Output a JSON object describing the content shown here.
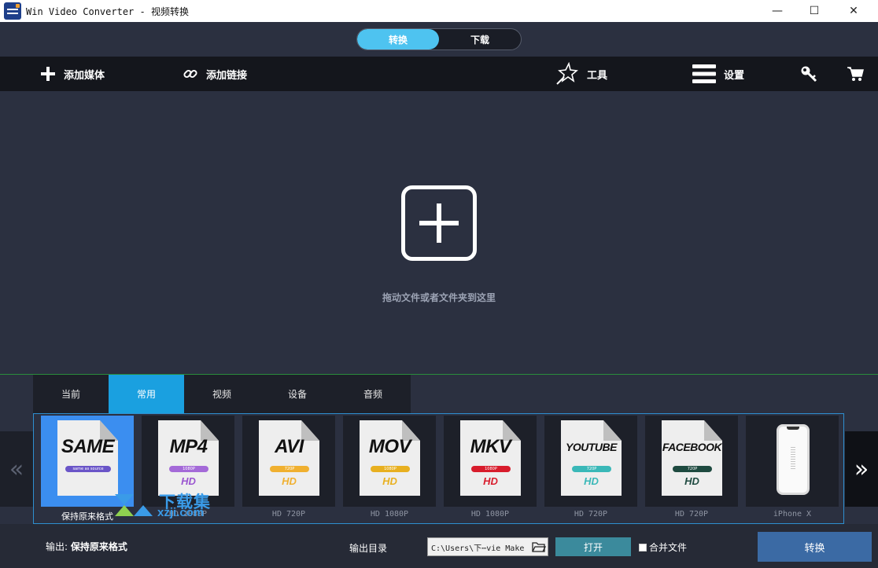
{
  "window": {
    "title": "Win Video Converter - 视频转换",
    "minimize_glyph": "—",
    "maximize_glyph": "☐",
    "close_glyph": "✕"
  },
  "mode_switch": {
    "tabs": [
      {
        "label": "转换",
        "active": true
      },
      {
        "label": "下载",
        "active": false
      }
    ]
  },
  "toolbar": {
    "add_media": "添加媒体",
    "add_link": "添加链接",
    "tools": "工具",
    "settings": "设置",
    "icons": [
      "plus-icon",
      "link-icon",
      "magic-wand-icon",
      "menu-icon",
      "key-icon",
      "cart-icon"
    ]
  },
  "drop_area": {
    "hint": "拖动文件或者文件夹到这里"
  },
  "format_tabs": [
    {
      "label": "当前",
      "active": false
    },
    {
      "label": "常用",
      "active": true
    },
    {
      "label": "视频",
      "active": false
    },
    {
      "label": "设备",
      "active": false
    },
    {
      "label": "音频",
      "active": false
    }
  ],
  "nav": {
    "prev": "«",
    "next": "»"
  },
  "formats": [
    {
      "name": "SAME",
      "sub": "same as source",
      "hd": "",
      "caption": "保持原来格式",
      "pill_color": "#6a55c8",
      "hd_color": "",
      "selected": true
    },
    {
      "name": "MP4",
      "sub": "1080P",
      "hd": "HD",
      "caption": "HD 1080P",
      "pill_color": "#a46ad8",
      "hd_color": "#9a55d0",
      "selected": false
    },
    {
      "name": "AVI",
      "sub": "720P",
      "hd": "HD",
      "caption": "HD 720P",
      "pill_color": "#f0b030",
      "hd_color": "#f0b030",
      "selected": false
    },
    {
      "name": "MOV",
      "sub": "1080P",
      "hd": "HD",
      "caption": "HD 1080P",
      "pill_color": "#e8b020",
      "hd_color": "#e8b020",
      "selected": false
    },
    {
      "name": "MKV",
      "sub": "1080P",
      "hd": "HD",
      "caption": "HD 1080P",
      "pill_color": "#d81c2c",
      "hd_color": "#d81c2c",
      "selected": false
    },
    {
      "name": "YOUTUBE",
      "sub": "720P",
      "hd": "HD",
      "caption": "HD 720P",
      "pill_color": "#3ab8b8",
      "hd_color": "#3ab8b8",
      "selected": false
    },
    {
      "name": "FACEBOOK",
      "sub": "720P",
      "hd": "HD",
      "caption": "HD 720P",
      "pill_color": "#1e4a40",
      "hd_color": "#1e4a40",
      "selected": false
    },
    {
      "name": "",
      "sub": "",
      "hd": "",
      "caption": "iPhone X",
      "pill_color": "",
      "hd_color": "",
      "selected": false
    }
  ],
  "watermark": {
    "text": "下载集",
    "url": "xzji.com"
  },
  "bottom": {
    "output_prefix": "输出: ",
    "output_value": "保持原来格式",
    "dir_label": "输出目录",
    "path_value": "C:\\Users\\下⋯vie Make",
    "open_label": "打开",
    "merge_label": "合并文件",
    "merge_checked": false,
    "convert_label": "转换"
  }
}
